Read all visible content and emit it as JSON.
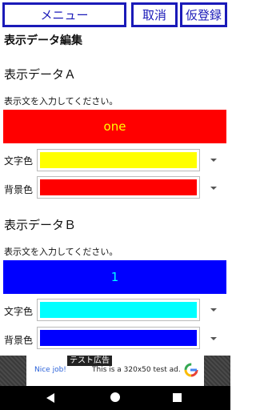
{
  "toolbar": {
    "menu_label": "メニュー",
    "cancel_label": "取消",
    "temp_register_label": "仮登録"
  },
  "page_title": "表示データ編集",
  "sections": [
    {
      "title": "表示データＡ",
      "prompt": "表示文を入力してください。",
      "text_value": "one",
      "text_color": "#ffff00",
      "bg_color": "#ff0000",
      "text_color_label": "文字色",
      "bg_color_label": "背景色"
    },
    {
      "title": "表示データＢ",
      "prompt": "表示文を入力してください。",
      "text_value": "1",
      "text_color": "#00ffff",
      "bg_color": "#0000ff",
      "text_color_label": "文字色",
      "bg_color_label": "背景色"
    }
  ],
  "ad": {
    "badge": "テスト広告",
    "headline": "Nice job!",
    "description": "This is a 320x50 test ad."
  },
  "navbar": {
    "back_icon": "back-triangle-icon",
    "home_icon": "home-circle-icon",
    "recent_icon": "recent-square-icon"
  }
}
